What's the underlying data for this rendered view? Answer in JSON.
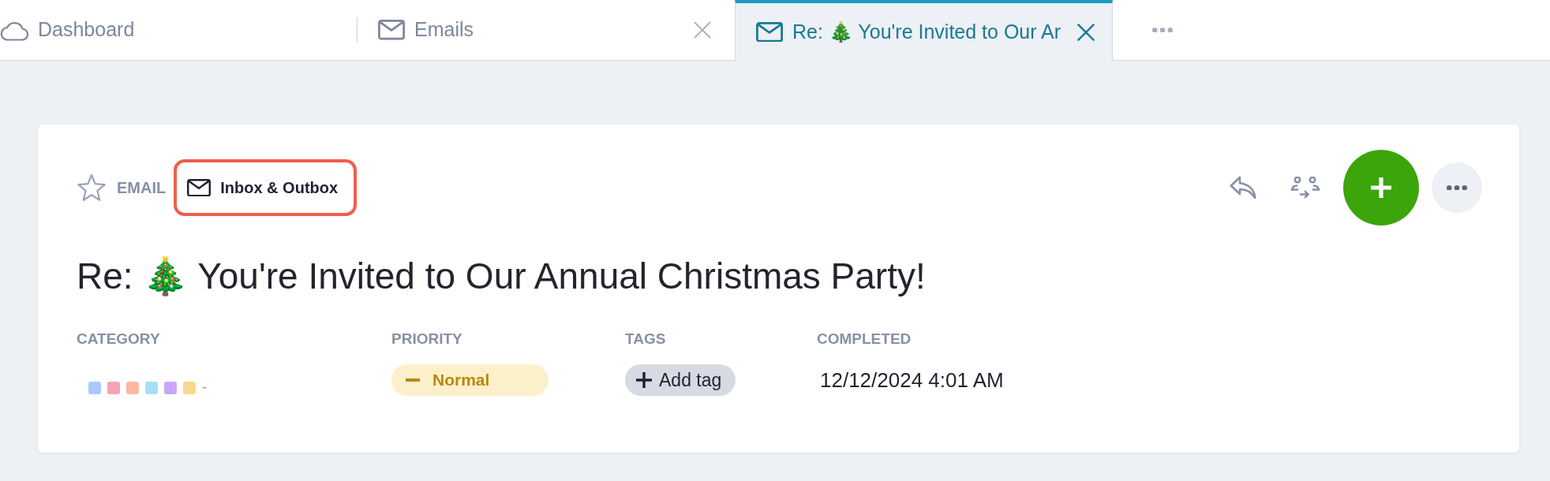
{
  "tabs": [
    {
      "kind": "dashboard",
      "label": "Dashboard",
      "selected": false,
      "closable": false
    },
    {
      "kind": "email",
      "label": "Emails",
      "selected": false,
      "closable": true
    },
    {
      "kind": "email",
      "label": "Re: 🎄 You're Invited to Our Ar",
      "selected": true,
      "closable": true
    }
  ],
  "record": {
    "starred": false,
    "type": "EMAIL",
    "folder": {
      "label": "Inbox & Outbox",
      "highlighted": true
    },
    "title": "Re: 🎄 You're Invited to Our Annual Christmas Party!",
    "fields": [
      {
        "kind": "category",
        "label": "CATEGORY",
        "swatches": [
          {
            "color": "#a9c9fb"
          },
          {
            "color": "#f5a3b5"
          },
          {
            "color": "#fdb9a0"
          },
          {
            "color": "#a6e0f5"
          },
          {
            "color": "#c9a6f8"
          },
          {
            "color": "#f8d98a"
          }
        ],
        "value": "-"
      },
      {
        "kind": "priority",
        "label": "PRIORITY",
        "value": "Normal"
      },
      {
        "kind": "tags",
        "label": "TAGS",
        "button": "Add tag"
      },
      {
        "kind": "text",
        "label": "COMPLETED",
        "value": "12/12/2024 4:01 AM"
      }
    ]
  }
}
